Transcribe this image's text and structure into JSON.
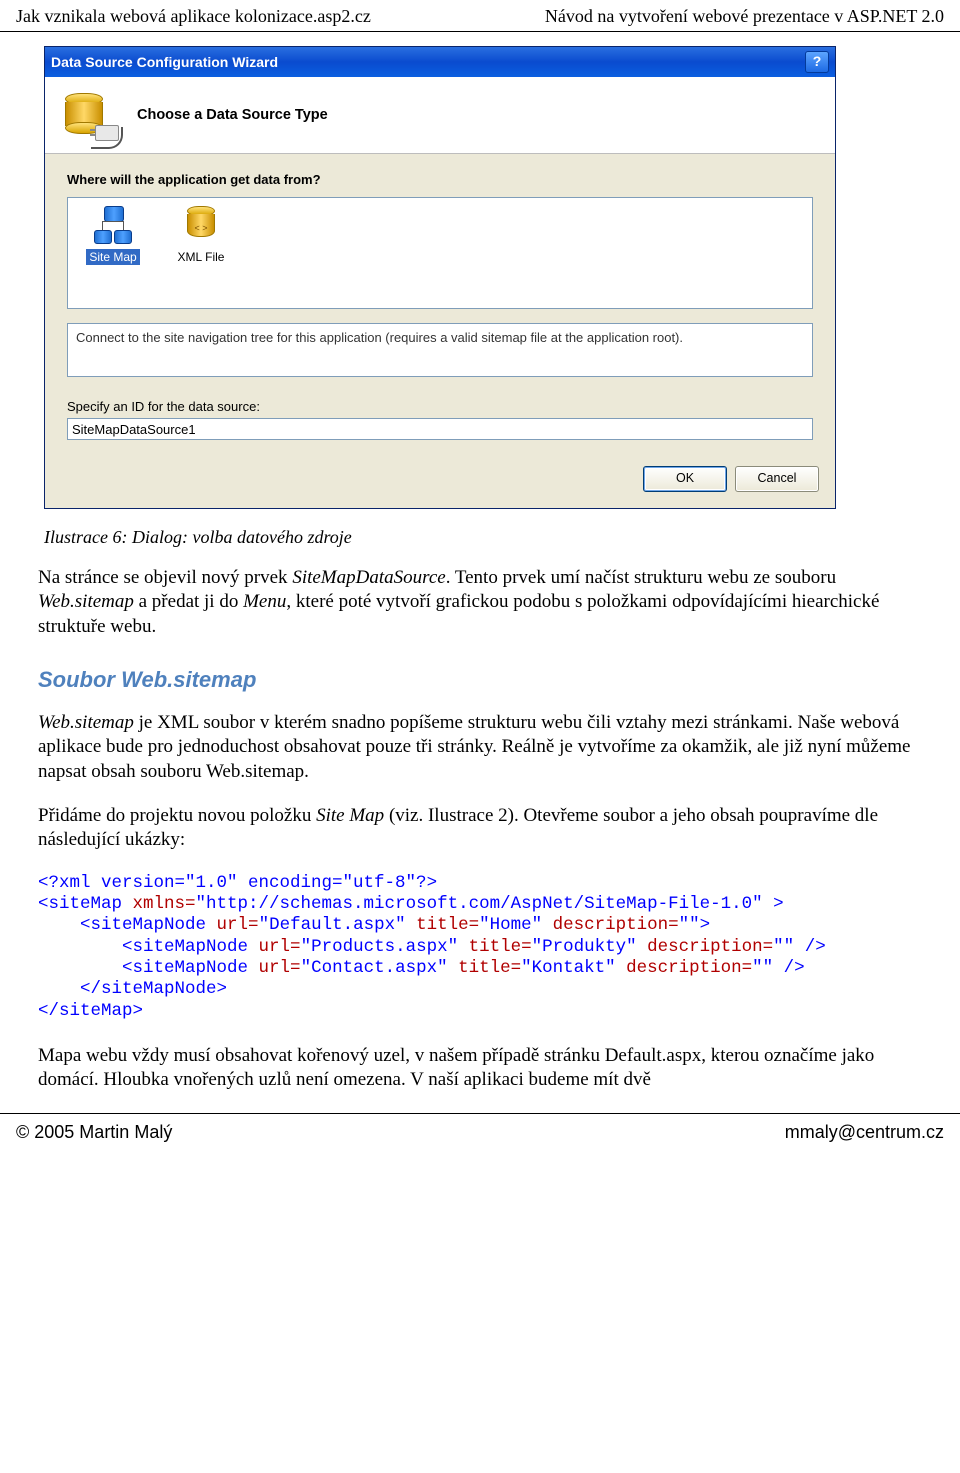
{
  "header": {
    "left": "Jak vznikala webová aplikace kolonizace.asp2.cz",
    "right": "Návod na vytvoření webové prezentace v ASP.NET 2.0"
  },
  "dialog": {
    "title": "Data Source Configuration Wizard",
    "help_symbol": "?",
    "banner_title": "Choose a Data Source Type",
    "question": "Where will the application get data from?",
    "options": {
      "sitemap": "Site Map",
      "xmlfile": "XML File",
      "xml_tag": "< >"
    },
    "description": "Connect to the site navigation tree for this application (requires a valid sitemap file at the application root).",
    "id_label": "Specify an ID for the data source:",
    "id_value": "SiteMapDataSource1",
    "ok_label": "OK",
    "cancel_label": "Cancel"
  },
  "caption": "Ilustrace 6: Dialog: volba datového zdroje",
  "para1_a": "Na stránce se objevil nový prvek ",
  "para1_b": "SiteMapDataSource",
  "para1_c": ". Tento prvek umí načíst strukturu webu ze souboru ",
  "para1_d": "Web.sitemap",
  "para1_e": " a předat ji do ",
  "para1_f": "Menu",
  "para1_g": ", které poté vytvoří grafickou podobu s položkami odpovídajícími hiearchické struktuře webu.",
  "heading2": "Soubor Web.sitemap",
  "para2_a": "Web.sitemap",
  "para2_b": " je XML soubor v kterém snadno popíšeme strukturu webu čili vztahy mezi stránkami. Naše webová aplikace bude pro jednoduchost obsahovat pouze tři stránky. Reálně je vytvoříme za okamžik, ale již nyní můžeme napsat obsah souboru Web.sitemap.",
  "para3_a": "Přidáme do projektu novou položku ",
  "para3_b": "Site Map",
  "para3_c": " (viz. Ilustrace 2). Otevřeme soubor a jeho obsah poupravíme dle následující ukázky:",
  "code": {
    "l1": "<?xml version=\"1.0\" encoding=\"utf-8\"?>",
    "sitemap_open": "<siteMap",
    "sitemap_ns_attr": " xmlns=",
    "sitemap_ns_val": "\"http://schemas.microsoft.com/AspNet/SiteMap-File-1.0\"",
    "close_tag": " >",
    "node_open": "<siteMapNode",
    "url_attr": " url=",
    "title_attr": " title=",
    "desc_attr": " description=",
    "empty_val": "\"\"",
    "gt": ">",
    "selfclose": " />",
    "root_url": "\"Default.aspx\"",
    "root_title": "\"Home\"",
    "prod_url": "\"Products.aspx\"",
    "prod_title": "\"Produkty\"",
    "cont_url": "\"Contact.aspx\"",
    "cont_title": "\"Kontakt\"",
    "node_close": "</siteMapNode>",
    "sitemap_close": "</siteMap>"
  },
  "para4": "Mapa webu vždy musí obsahovat kořenový uzel, v našem případě stránku Default.aspx, kterou označíme jako domácí. Hloubka vnořených uzlů není omezena. V naší aplikaci budeme mít dvě",
  "footer": {
    "left": "© 2005 Martin Malý",
    "right": "mmaly@centrum.cz"
  }
}
